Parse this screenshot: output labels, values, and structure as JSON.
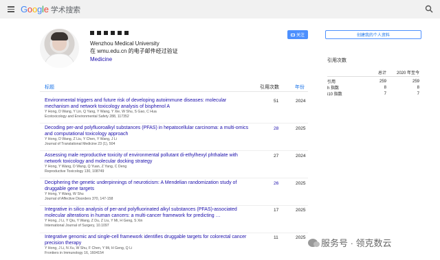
{
  "header": {
    "logo_text": "Google",
    "logo_sub": "学术搜索"
  },
  "profile": {
    "affiliation": "Wenzhou Medical University",
    "email": "在 wmu.edu.cn 的电子邮件经过验证",
    "field": "Medicine",
    "follow_label": "关注",
    "create_label": "创建我的个人资料"
  },
  "citations": {
    "title": "引用次数",
    "col_all": "总计",
    "col_since": "2020 年至今",
    "rows": [
      {
        "label": "引用",
        "all": "259",
        "since": "259"
      },
      {
        "label": "h 指数",
        "all": "8",
        "since": "8"
      },
      {
        "label": "i10 指数",
        "all": "7",
        "since": "7"
      }
    ]
  },
  "table": {
    "col_title": "标题",
    "col_cites": "引用次数",
    "col_year": "年份"
  },
  "articles": [
    {
      "title": "Environmental triggers and future risk of developing autoimmune diseases: molecular mechanism and network toxicology analysis of bisphenol A",
      "authors": "Y Hong, D Wang, Y Lin, Q Yang, Y Wang, Y Xie, W Shu, S Gao, C Hua",
      "venue": "Ecotoxicology and Environmental Safety 288, 117352",
      "cites": "51",
      "year": "2024"
    },
    {
      "title": "Decoding per-and polyfluoroalkyl substances (PFAS) in hepatocellular carcinoma: a multi-omics and computational toxicology approach",
      "authors": "Y Hong, D Wang, Z Liu, Y Chen, Y Wang, J Li",
      "venue": "Journal of Translational Medicine 23 (1), 504",
      "cites": "28",
      "year": "2025"
    },
    {
      "title": "Assessing male reproductive toxicity of environmental pollutant di-ethylhexyl phthalate with network toxicology and molecular docking strategy",
      "authors": "Y Hong, Y Wang, D Wang, Q Yuan, Z Yang, C Deng",
      "venue": "Reproductive Toxicology 130, 108749",
      "cites": "27",
      "year": "2024"
    },
    {
      "title": "Deciphering the genetic underpinnings of neuroticism: A Mendelian randomization study of druggable gene targets",
      "authors": "Y Hong, Y Wang, W Shu",
      "venue": "Journal of Affective Disorders 370, 147-158",
      "cites": "26",
      "year": "2025"
    },
    {
      "title": "Integrative in silico analysis of per-and polyfluorinated alkyl substances (PFAS)-associated molecular alterations in human cancers: a multi-cancer framework for predicting …",
      "authors": "Y Hong, J Li, Y Qiu, Y Wang, Z Du, Z Liu, Y Mi, H Geng, S Xin",
      "venue": "International Journal of Surgery, 10.1097",
      "cites": "17",
      "year": "2025"
    },
    {
      "title": "Integrative genomic and single-cell framework identifies druggable targets for colorectal cancer precision therapy",
      "authors": "Y Hong, J Li, N Xu, W Shu, F Chen, Y Mi, H Geng, Q Li",
      "venue": "Frontiers in Immunology 16, 1604154",
      "cites": "11",
      "year": "2025"
    }
  ],
  "watermark": "服务号 · 领克数云"
}
